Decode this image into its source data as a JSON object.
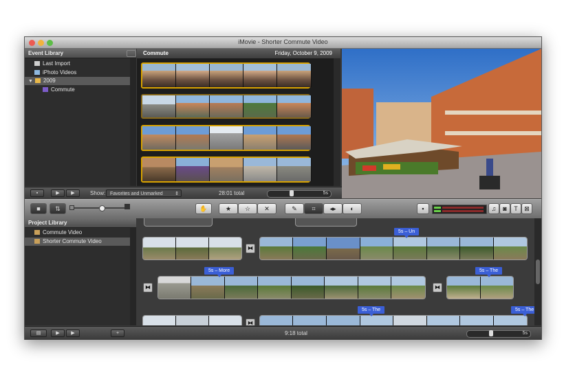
{
  "window": {
    "title": "iMovie - Shorter Commute Video",
    "traffic_lights": [
      "#ec5b52",
      "#f2b33d",
      "#5dbd47"
    ]
  },
  "event_library": {
    "header": "Event Library",
    "items": [
      {
        "label": "Last Import",
        "icon": "film-icon"
      },
      {
        "label": "iPhoto Videos",
        "icon": "iphoto-icon"
      },
      {
        "label": "2009",
        "icon": "folder-icon",
        "expanded": true,
        "selected": true
      },
      {
        "label": "Commute",
        "icon": "event-star-icon"
      }
    ]
  },
  "event_browser": {
    "event_name": "Commute",
    "date": "Friday, October 9, 2009",
    "show_label": "Show:",
    "filter_value": "Favorites and Unmarked",
    "total": "28:01 total",
    "zoom_value": "5s"
  },
  "toolbar": {
    "tools": [
      "select-hand-icon",
      "favorite-star-icon",
      "unfavorite-star-icon",
      "reject-x-icon",
      "keyword-icon",
      "crop-icon",
      "audio-icon",
      "adjust-icon"
    ],
    "right_tools": [
      "music-icon",
      "photo-icon",
      "title-icon",
      "map-icon"
    ]
  },
  "project_library": {
    "header": "Project Library",
    "items": [
      {
        "label": "Commute Video",
        "selected": false
      },
      {
        "label": "Shorter Commute Video",
        "selected": true
      }
    ]
  },
  "project": {
    "tags": [
      "5s – Un",
      "5s – More",
      "5s – The",
      "5s – The",
      "5s – The"
    ],
    "total": "9:18 total",
    "zoom_value": "5s"
  },
  "colors": {
    "accent": "#3b5fd6",
    "clip_border": "#d9a300",
    "window_bg": "#3a3a3a"
  }
}
